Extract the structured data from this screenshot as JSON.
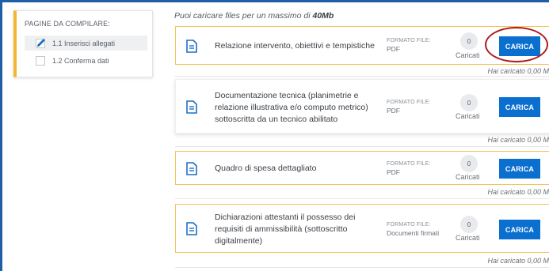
{
  "sidebar": {
    "title": "PAGINE DA COMPILARE:",
    "steps": [
      {
        "label": "1.1 Inserisci allegati",
        "active": true
      },
      {
        "label": "1.2 Conferma dati",
        "active": false
      }
    ]
  },
  "note": {
    "prefix": "Puoi caricare files per un massimo di ",
    "limit": "40Mb"
  },
  "documents": [
    {
      "title": "Relazione intervento, obiettivi e tempistiche",
      "format_label": "FORMATO FILE:",
      "format_value": "PDF",
      "count": "0",
      "count_label": "Caricati",
      "button": "CARICA",
      "uploaded": "Hai caricato 0,00 M"
    },
    {
      "title": "Documentazione tecnica (planimetrie e relazione illustrativa e/o computo metrico) sottoscritta da un tecnico abilitato",
      "format_label": "FORMATO FILE:",
      "format_value": "PDF",
      "count": "0",
      "count_label": "Caricati",
      "button": "CARICA",
      "uploaded": "Hai caricato 0,00 M"
    },
    {
      "title": "Quadro di spesa dettagliato",
      "format_label": "FORMATO FILE:",
      "format_value": "PDF",
      "count": "0",
      "count_label": "Caricati",
      "button": "CARICA",
      "uploaded": "Hai caricato 0,00 M"
    },
    {
      "title": "Dichiarazioni attestanti il possesso dei requisiti di ammissibilità (sottoscritto digitalmente)",
      "format_label": "FORMATO FILE:",
      "format_value": "Documenti firmati",
      "count": "0",
      "count_label": "Caricati",
      "button": "CARICA",
      "uploaded": "Hai caricato 0,00 M"
    }
  ],
  "colors": {
    "accent": "#0b6fd0",
    "card_border": "#f3c45a",
    "sidebar_accent": "#f2b632",
    "highlight": "#b01b1b",
    "frame": "#1f5fa6"
  }
}
